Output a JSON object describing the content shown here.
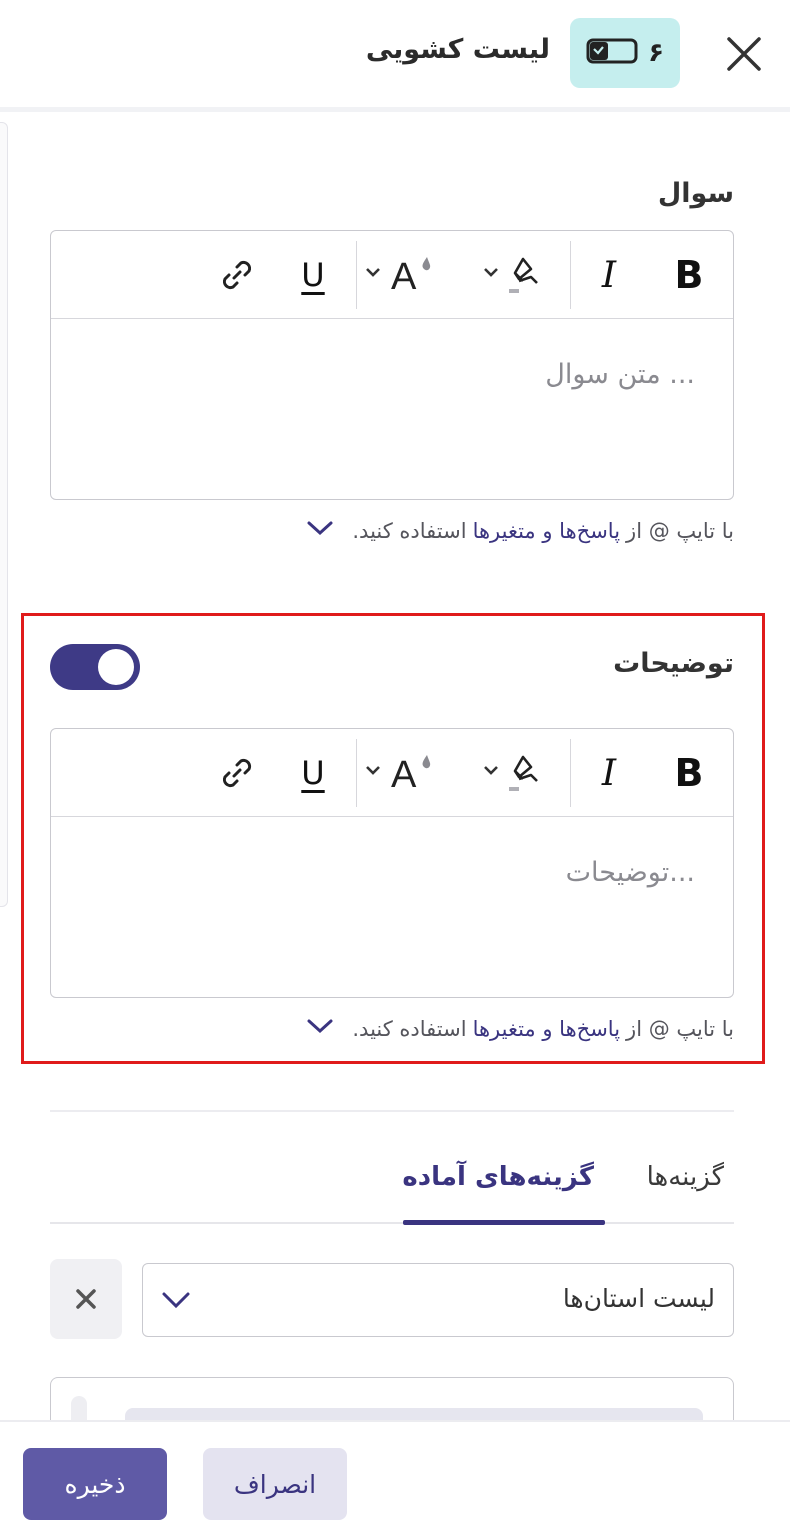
{
  "header": {
    "title": "لیست کشویی",
    "question_number": "۶",
    "close_icon": "close-icon",
    "type_icon": "dropdown-icon"
  },
  "question": {
    "label": "سوال",
    "placeholder": "متن سوال ...",
    "helper_prefix": "با تایپ @ از",
    "helper_link": "پاسخ‌ها و متغیرها",
    "helper_suffix": "استفاده کنید."
  },
  "description": {
    "label": "توضیحات",
    "enabled": true,
    "placeholder": "توضیحات...",
    "helper_prefix": "با تایپ @ از",
    "helper_link": "پاسخ‌ها و متغیرها",
    "helper_suffix": "استفاده کنید."
  },
  "toolbar": {
    "bold": "B",
    "italic": "I",
    "font_color": "A",
    "underline": "U"
  },
  "tabs": [
    {
      "label": "گزینه‌ها",
      "active": false
    },
    {
      "label": "گزینه‌های آماده",
      "active": true
    }
  ],
  "preset_select": {
    "value": "لیست استان‌ها"
  },
  "footer": {
    "save_label": "ذخیره",
    "cancel_label": "انصراف"
  },
  "colors": {
    "accent": "#3e3a86",
    "badge_bg": "#c5eeee",
    "highlight": "#e01b1b",
    "save_bg": "#5f5aa6",
    "cancel_bg": "#e4e3f0"
  }
}
